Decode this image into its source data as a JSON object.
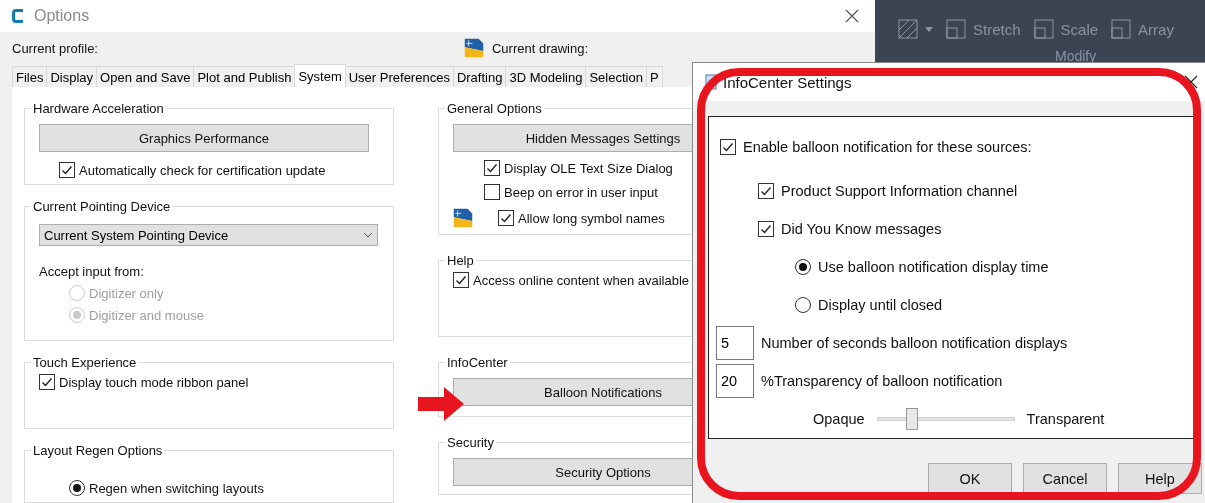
{
  "options_window": {
    "title": "Options",
    "current_profile_label": "Current profile:",
    "current_drawing_label": "Current drawing:",
    "tabs": [
      {
        "label": "Files",
        "selected": false
      },
      {
        "label": "Display",
        "selected": false
      },
      {
        "label": "Open and Save",
        "selected": false
      },
      {
        "label": "Plot and Publish",
        "selected": false
      },
      {
        "label": "System",
        "selected": true
      },
      {
        "label": "User Preferences",
        "selected": false
      },
      {
        "label": "Drafting",
        "selected": false
      },
      {
        "label": "3D Modeling",
        "selected": false
      },
      {
        "label": "Selection",
        "selected": false
      },
      {
        "label": "P",
        "selected": false
      }
    ],
    "left_column": [
      {
        "title": "Hardware Acceleration",
        "items": [
          {
            "kind": "button",
            "label": "Graphics Performance"
          },
          {
            "kind": "checkbox",
            "label": "Automatically check for certification update",
            "checked": true
          }
        ]
      },
      {
        "title": "Current Pointing Device",
        "items": [
          {
            "kind": "dropdown",
            "value": "Current System Pointing Device"
          },
          {
            "kind": "label",
            "label": "Accept input from:"
          },
          {
            "kind": "radio",
            "label": "Digitizer only",
            "selected": false,
            "disabled": true
          },
          {
            "kind": "radio",
            "label": "Digitizer and mouse",
            "selected": true,
            "disabled": true
          }
        ]
      },
      {
        "title": "Touch Experience",
        "items": [
          {
            "kind": "checkbox",
            "label": "Display touch mode ribbon panel",
            "checked": true
          }
        ]
      },
      {
        "title": "Layout Regen Options",
        "items": [
          {
            "kind": "radio",
            "label": "Regen when switching layouts",
            "selected": true,
            "disabled": false
          }
        ]
      }
    ],
    "right_column": [
      {
        "title": "General Options",
        "items": [
          {
            "kind": "button",
            "label": "Hidden Messages Settings"
          },
          {
            "kind": "checkbox",
            "label": "Display OLE Text Size Dialog",
            "checked": true
          },
          {
            "kind": "checkbox",
            "label": "Beep on error in user input",
            "checked": false
          },
          {
            "kind": "checkbox",
            "label": "Allow long symbol names",
            "checked": true,
            "marker_icon": true
          }
        ]
      },
      {
        "title": "Help",
        "items": [
          {
            "kind": "checkbox",
            "label": "Access online content when available",
            "checked": true
          }
        ]
      },
      {
        "title": "InfoCenter",
        "items": [
          {
            "kind": "button",
            "label": "Balloon Notifications"
          }
        ]
      },
      {
        "title": "Security",
        "items": [
          {
            "kind": "button",
            "label": "Security Options"
          }
        ]
      }
    ]
  },
  "ribbon": {
    "tools": [
      "Stretch",
      "Scale",
      "Array"
    ],
    "panel_label": "Modify"
  },
  "infocenter_settings": {
    "title": "InfoCenter Settings",
    "enable": {
      "label": "Enable balloon notification for these sources:",
      "checked": true
    },
    "sources": [
      {
        "label": "Product Support Information channel",
        "checked": true
      },
      {
        "label": "Did You Know messages",
        "checked": true
      }
    ],
    "display_modes": [
      {
        "label": "Use balloon notification display time",
        "selected": true
      },
      {
        "label": "Display until closed",
        "selected": false
      }
    ],
    "fields": [
      {
        "value": "5",
        "label": "Number of seconds balloon notification displays"
      },
      {
        "value": "20",
        "label": "%Transparency of balloon notification"
      }
    ],
    "slider": {
      "min_label": "Opaque",
      "max_label": "Transparent",
      "level": 0.25
    },
    "buttons": [
      "OK",
      "Cancel",
      "Help"
    ]
  },
  "annotation": {
    "outline": true,
    "arrow": true
  }
}
